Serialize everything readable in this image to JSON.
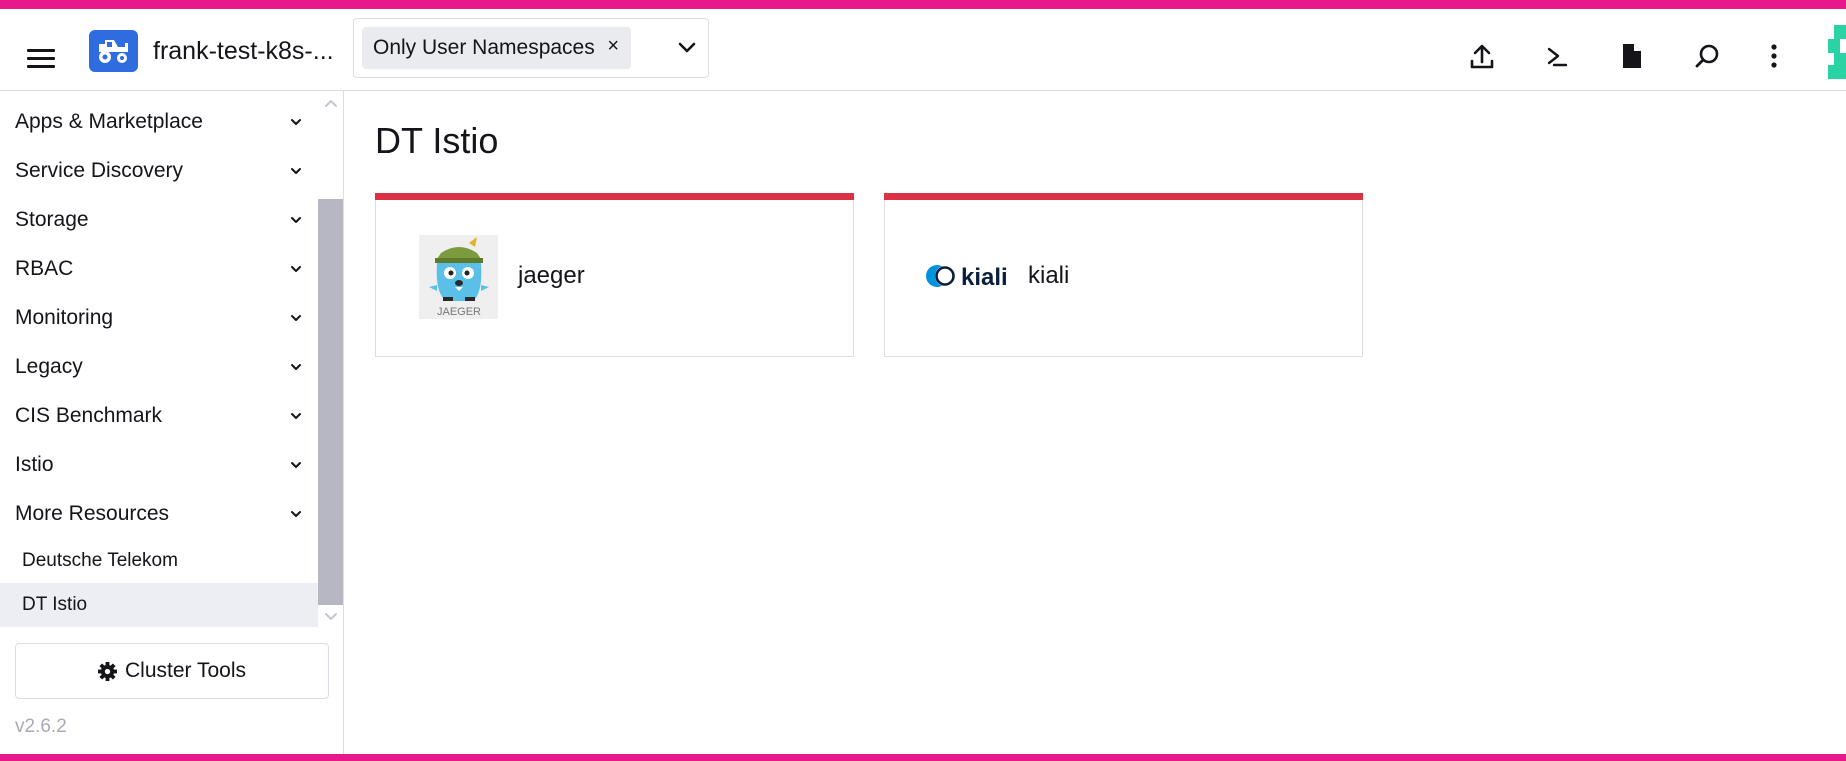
{
  "header": {
    "cluster_name": "frank-test-k8s-...",
    "namespace_filter": {
      "selected": "Only User Namespaces",
      "clear_symbol": "×"
    }
  },
  "sidebar": {
    "groups": [
      {
        "label": "Apps & Marketplace"
      },
      {
        "label": "Service Discovery"
      },
      {
        "label": "Storage"
      },
      {
        "label": "RBAC"
      },
      {
        "label": "Monitoring"
      },
      {
        "label": "Legacy"
      },
      {
        "label": "CIS Benchmark"
      },
      {
        "label": "Istio"
      },
      {
        "label": "More Resources"
      }
    ],
    "items": [
      {
        "label": "Deutsche Telekom"
      },
      {
        "label": "DT Istio",
        "active": true
      }
    ],
    "cluster_tools_label": "Cluster Tools",
    "version": "v2.6.2"
  },
  "main": {
    "title": "DT Istio",
    "tiles": [
      {
        "label": "jaeger",
        "logo_text": "JAEGER"
      },
      {
        "label": "kiali",
        "logo_text": "kiali"
      }
    ]
  },
  "colors": {
    "brand_stripe": "#e8178a",
    "tile_accent": "#dc3045",
    "cluster_logo": "#2f6ce0"
  }
}
